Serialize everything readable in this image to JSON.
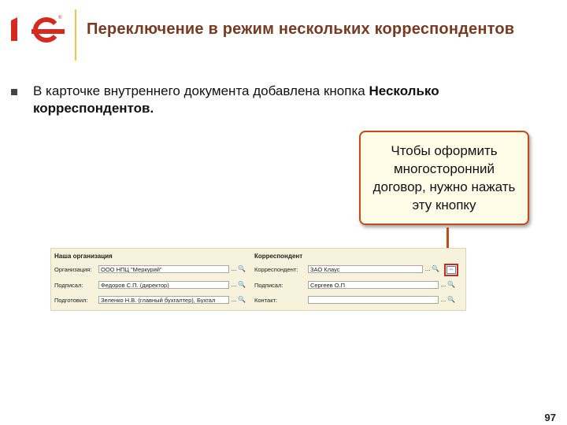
{
  "slide": {
    "title": "Переключение в режим нескольких корреспондентов",
    "bullet_text_prefix": "В карточке внутреннего документа добавлена кнопка ",
    "bullet_text_bold": "Несколько корреспондентов.",
    "callout": "Чтобы оформить многосторонний договор, нужно нажать эту кнопку",
    "page_number": "97",
    "logo_text": "1С"
  },
  "form": {
    "org_section": "Наша организация",
    "corr_section": "Корреспондент",
    "left_rows": [
      {
        "label": "Организация:",
        "value": "ООО НПЦ \"Меркурий\""
      },
      {
        "label": "Подписал:",
        "value": "Федоров С.П. (директор)"
      },
      {
        "label": "Подготовил:",
        "value": "Зеленко Н.В. (главный бухгалтер), Бухгал"
      }
    ],
    "right_rows": [
      {
        "label": "Корреспондент:",
        "value": "ЗАО Клаус"
      },
      {
        "label": "Подписал:",
        "value": "Сергеев О.П"
      },
      {
        "label": "Контакт:",
        "value": ""
      }
    ],
    "select_button": "...",
    "search_glyph": "🔍",
    "multi_corr_button_glyph": "⇔"
  },
  "colors": {
    "title": "#7a3a22",
    "accent": "#c64a16",
    "logo_red": "#d52b1e"
  }
}
